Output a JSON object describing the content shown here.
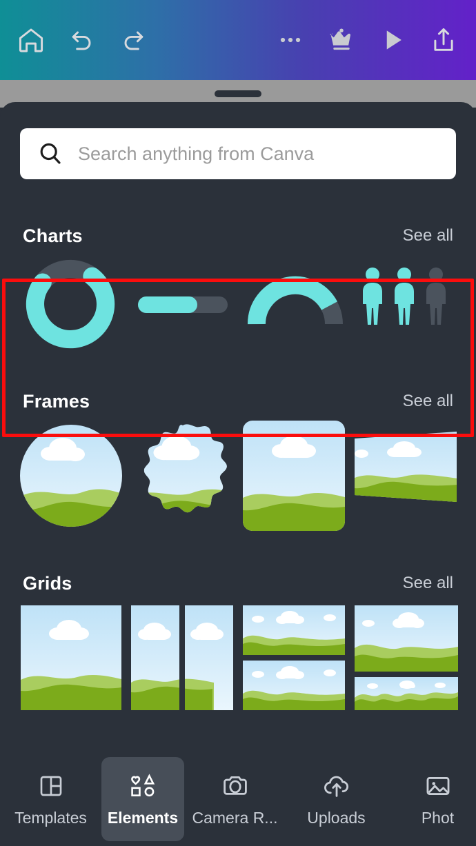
{
  "topbar": {
    "gradient_from": "#0f8f96",
    "gradient_to": "#6321c9",
    "icons": [
      {
        "name": "home-icon",
        "label": "Home"
      },
      {
        "name": "undo-icon",
        "label": "Undo"
      },
      {
        "name": "redo-icon",
        "label": "Redo"
      },
      {
        "name": "more-options-icon",
        "label": "More options"
      },
      {
        "name": "crown-icon",
        "label": "Canva Pro"
      },
      {
        "name": "play-icon",
        "label": "Present"
      },
      {
        "name": "share-icon",
        "label": "Share"
      }
    ]
  },
  "search": {
    "placeholder": "Search anything from Canva",
    "value": "",
    "icon": "search-icon"
  },
  "sections": [
    {
      "title": "Charts",
      "see_all": "See all",
      "highlighted": false,
      "items": [
        {
          "name": "donut-chart",
          "label": "Donut chart"
        },
        {
          "name": "progress-bar-chart",
          "label": "Progress bar"
        },
        {
          "name": "gauge-chart",
          "label": "Gauge chart"
        },
        {
          "name": "pictogram-chart",
          "label": "Pictogram"
        }
      ]
    },
    {
      "title": "Frames",
      "see_all": "See all",
      "highlighted": true,
      "highlight_color": "#fb0d0d",
      "items": [
        {
          "name": "frame-circle",
          "label": "Circle frame"
        },
        {
          "name": "frame-scalloped",
          "label": "Scalloped frame"
        },
        {
          "name": "frame-rounded-rect",
          "label": "Rounded rectangle frame"
        },
        {
          "name": "frame-perspective",
          "label": "Perspective frame"
        }
      ]
    },
    {
      "title": "Grids",
      "see_all": "See all",
      "highlighted": false,
      "items": [
        {
          "name": "grid-single",
          "label": "Single panel grid"
        },
        {
          "name": "grid-two-column",
          "label": "Two column grid"
        },
        {
          "name": "grid-two-row",
          "label": "Two row grid"
        },
        {
          "name": "grid-uneven-row",
          "label": "Uneven two row grid"
        }
      ]
    }
  ],
  "bottomnav": {
    "items": [
      {
        "label": "Templates",
        "icon": "templates-icon",
        "active": false
      },
      {
        "label": "Elements",
        "icon": "elements-icon",
        "active": true
      },
      {
        "label": "Camera R...",
        "icon": "camera-roll-icon",
        "active": false
      },
      {
        "label": "Uploads",
        "icon": "uploads-icon",
        "active": false
      },
      {
        "label": "Phot",
        "icon": "photos-icon",
        "active": false
      }
    ]
  },
  "colors": {
    "panel_bg": "#2b313a",
    "chart_accent": "#6ee3e0",
    "chart_muted": "#4b535d",
    "sky_top": "#bfe2f7",
    "sky_bottom": "#e8f5fc",
    "hill_light": "#a9cd5f",
    "hill_dark": "#7cab1b",
    "highlight": "#fb0d0d"
  }
}
